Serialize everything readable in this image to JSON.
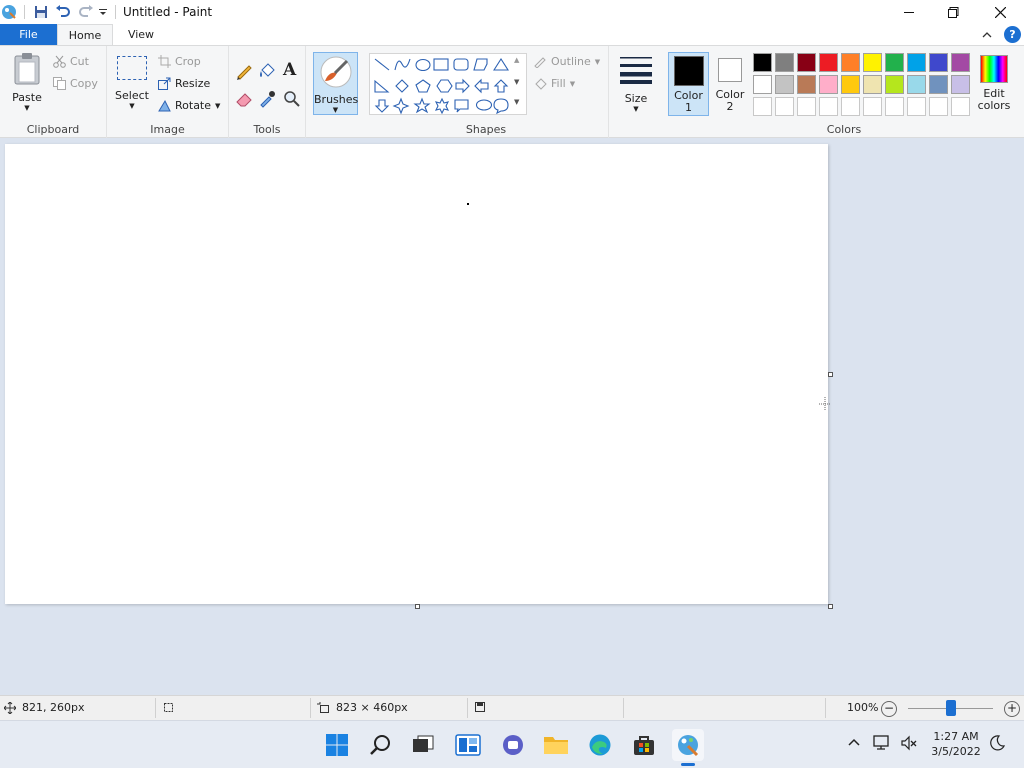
{
  "window": {
    "title": "Untitled - Paint"
  },
  "tabs": {
    "file": "File",
    "home": "Home",
    "view": "View"
  },
  "clipboard": {
    "paste": "Paste",
    "cut": "Cut",
    "copy": "Copy",
    "label": "Clipboard"
  },
  "image": {
    "select": "Select",
    "crop": "Crop",
    "resize": "Resize",
    "rotate": "Rotate",
    "label": "Image"
  },
  "tools": {
    "label": "Tools"
  },
  "brushes": {
    "label": "Brushes"
  },
  "shapes": {
    "outline": "Outline",
    "fill": "Fill",
    "label": "Shapes"
  },
  "size": {
    "label": "Size"
  },
  "colors": {
    "color1_line1": "Color",
    "color1_line2": "1",
    "color2_line1": "Color",
    "color2_line2": "2",
    "edit_line1": "Edit",
    "edit_line2": "colors",
    "label": "Colors",
    "row1": [
      "#000000",
      "#7f7f7f",
      "#880015",
      "#ed1c24",
      "#ff7f27",
      "#fff200",
      "#22b14c",
      "#00a2e8",
      "#3f48cc",
      "#a349a4"
    ],
    "row2": [
      "#ffffff",
      "#c3c3c3",
      "#b97a57",
      "#ffaec9",
      "#ffc90e",
      "#efe4b0",
      "#b5e61d",
      "#99d9ea",
      "#7092be",
      "#c8bfe7"
    ],
    "row3": [
      "#ffffff",
      "#ffffff",
      "#ffffff",
      "#ffffff",
      "#ffffff",
      "#ffffff",
      "#ffffff",
      "#ffffff",
      "#ffffff",
      "#ffffff"
    ],
    "primary": "#000000",
    "secondary": "#ffffff"
  },
  "status": {
    "cursor_pos": "821, 260px",
    "canvas_size": "823 × 460px",
    "zoom": "100%",
    "zoom_level": 0.5
  },
  "taskbar": {
    "time": "1:27 AM",
    "date": "3/5/2022",
    "icons": [
      "windows-start-icon",
      "search-icon",
      "task-view-icon",
      "widgets-icon",
      "teams-chat-icon",
      "file-explorer-icon",
      "edge-icon",
      "store-icon",
      "paint-icon"
    ]
  }
}
